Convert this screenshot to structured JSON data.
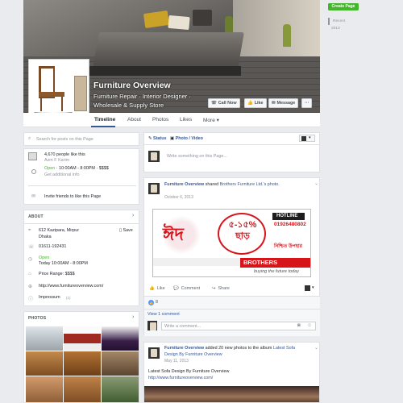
{
  "header": {
    "title": "Furniture Overview",
    "subtitle": "Furniture Repair · Interior Designer · Wholesale & Supply Store",
    "buttons": {
      "call_now": "Call Now",
      "like": "Like",
      "message": "Message",
      "more": "···"
    }
  },
  "tabs": [
    "Timeline",
    "About",
    "Photos",
    "Likes",
    "More ▾"
  ],
  "right_column": {
    "create_page": "Create Page",
    "years": [
      "Recent",
      "2013"
    ]
  },
  "sidebar": {
    "search_placeholder": "Search for posts on this Page",
    "likes_count": "4,670 people like this",
    "liker_name": "Azm F Karim",
    "hours_open": "Open",
    "hours_range": " · 10:00AM - 8:00PM · $$$$",
    "get_info": "Get additional info",
    "invite": "Invite friends to like this Page",
    "about_header": "ABOUT",
    "address": "612 Kazipara, Mirpur\nDhaka",
    "save_label": "Save",
    "phone": "01611-192431",
    "open_label": "Open",
    "today_hours": "Today 10:00AM - 8:00PM",
    "price_range": "Price Range: $$$$",
    "website": "http://www.furnitureoverview.com/",
    "impressum": "Impressum",
    "impressum_hint": "(1)",
    "photos_header": "PHOTOS"
  },
  "composer": {
    "status_tab": "Status",
    "photo_tab": "Photo / Video",
    "placeholder": "Write something on this Page..."
  },
  "post1": {
    "author": "Furniture Overview",
    "action_text": "shared",
    "shared_page": "Brothers Furniture Ltd.'s",
    "object": "photo.",
    "date": "October 6, 2013",
    "ad": {
      "brand_bn": "ঈদ",
      "discount_bn": "৫-১৫%\nছাড়",
      "hotline_label": "HOTLINE",
      "hotline_number": "01926480802",
      "gift_bn": "নিশ্চিত উপহার",
      "brand": "BROTHERS",
      "brand_suffix": "FURNITURE",
      "tagline": "buying the future today"
    },
    "like": "Like",
    "comment": "Comment",
    "share": "Share",
    "likes_count": "8",
    "view_comment": "View 1 comment",
    "comment_placeholder": "Write a comment..."
  },
  "post2": {
    "author": "Furniture Overview",
    "action_text": "added 20 new photos to the album",
    "album": "Latest Sofa Design By Furniture Overview",
    "date": "May 11, 2013",
    "body": "Latest Sofa Design By Furniture Overview",
    "link": "http://www.furnitureoverview.com/"
  },
  "colors": {
    "accent": "#365899",
    "green": "#42b72a",
    "ad_red": "#d8141b"
  }
}
